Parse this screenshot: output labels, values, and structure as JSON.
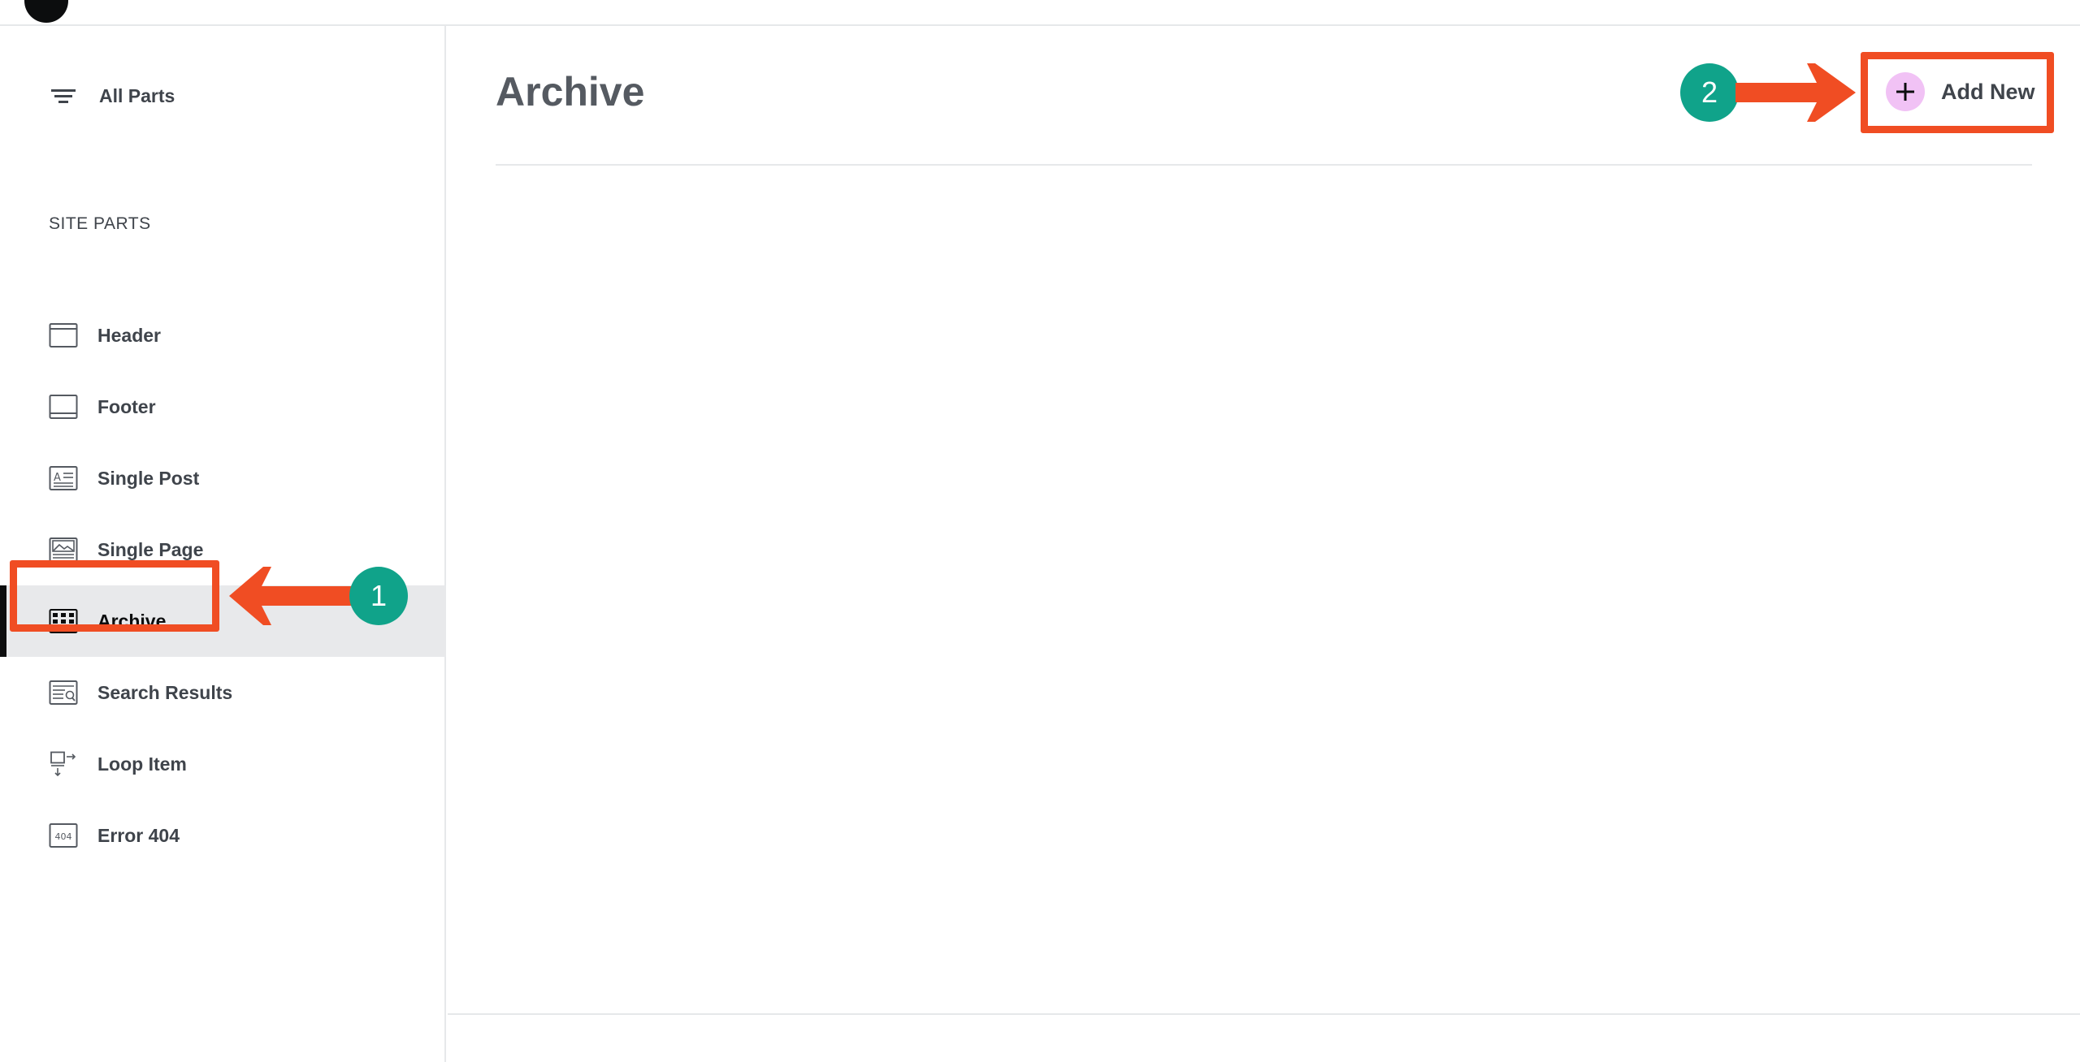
{
  "sidebar": {
    "all_parts_label": "All Parts",
    "section_title": "SITE PARTS",
    "items": [
      {
        "label": "Header",
        "icon": "header-icon"
      },
      {
        "label": "Footer",
        "icon": "footer-icon"
      },
      {
        "label": "Single Post",
        "icon": "single-post-icon"
      },
      {
        "label": "Single Page",
        "icon": "single-page-icon"
      },
      {
        "label": "Archive",
        "icon": "archive-icon",
        "active": true
      },
      {
        "label": "Search Results",
        "icon": "search-results-icon"
      },
      {
        "label": "Loop Item",
        "icon": "loop-item-icon"
      },
      {
        "label": "Error 404",
        "icon": "error-404-icon"
      }
    ]
  },
  "main": {
    "title": "Archive",
    "add_new_label": "Add New"
  },
  "annotations": {
    "step1": "1",
    "step2": "2",
    "error_icon_text": "404"
  },
  "colors": {
    "accent_highlight": "#f04d23",
    "badge": "#10a38a",
    "plus_circle": "#f1c2f5",
    "active_bg": "#e8e9eb"
  }
}
